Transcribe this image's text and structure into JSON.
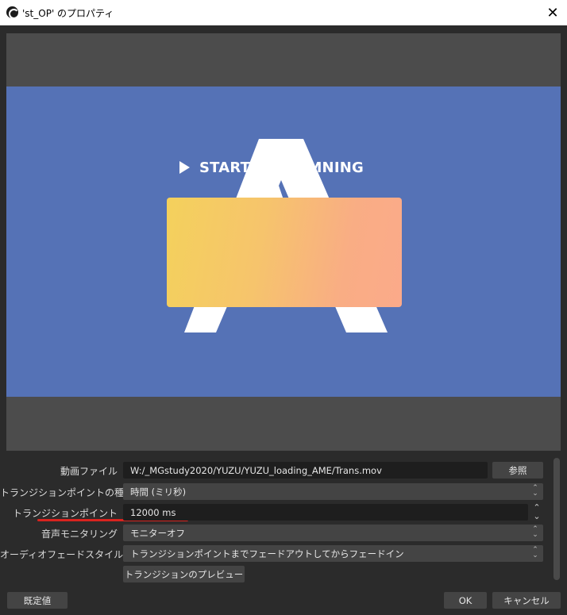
{
  "window": {
    "title": "'st_OP' のプロパティ",
    "close_glyph": "✕"
  },
  "preview": {
    "button_text_part1": "START",
    "button_text_part2": "STREAMNING"
  },
  "properties": {
    "media_file": {
      "label": "動画ファイル",
      "value": "W:/_MGstudy2020/YUZU/YUZU_loading_AME/Trans.mov",
      "browse_label": "参照"
    },
    "transition_point_type": {
      "label": "トランジションポイントの種類",
      "value": "時間 (ミリ秒)"
    },
    "transition_point": {
      "label": "トランジションポイント",
      "value": "12000 ms"
    },
    "audio_monitoring": {
      "label": "音声モニタリング",
      "value": "モニターオフ"
    },
    "audio_fade_style": {
      "label": "オーディオフェードスタイル",
      "value": "トランジションポイントまでフェードアウトしてからフェードイン"
    },
    "preview_transition_label": "トランジションのプレビュー"
  },
  "footer": {
    "defaults_label": "既定値",
    "ok_label": "OK",
    "cancel_label": "キャンセル"
  },
  "colors": {
    "video_bg": "#5572b6",
    "underline": "#d9231f"
  },
  "icons": {
    "app": "obs-icon",
    "close": "close-icon",
    "spinner": "spin-arrows-icon",
    "play": "play-icon"
  }
}
